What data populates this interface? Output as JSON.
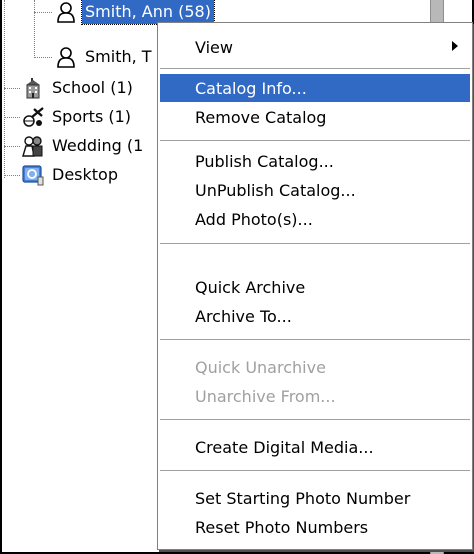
{
  "tree": {
    "items": [
      {
        "label": "Smith, Ann (58)",
        "icon": "person-icon",
        "selected": true
      },
      {
        "label": "Smith, T",
        "icon": "person-icon",
        "selected": false
      },
      {
        "label": "School (1)",
        "icon": "school-icon",
        "selected": false
      },
      {
        "label": "Sports (1)",
        "icon": "sports-icon",
        "selected": false
      },
      {
        "label": "Wedding (1",
        "icon": "wedding-icon",
        "selected": false
      },
      {
        "label": "Desktop",
        "icon": "desktop-icon",
        "selected": false
      }
    ]
  },
  "context_menu": {
    "items": [
      {
        "label": "View",
        "state": "normal",
        "submenu": true
      },
      {
        "label": "Catalog Info...",
        "state": "highlighted"
      },
      {
        "label": "Remove Catalog",
        "state": "normal"
      },
      {
        "label": "Publish Catalog...",
        "state": "normal"
      },
      {
        "label": "UnPublish Catalog...",
        "state": "normal"
      },
      {
        "label": "Add Photo(s)...",
        "state": "normal"
      },
      {
        "label": "Quick Archive",
        "state": "normal"
      },
      {
        "label": "Archive To...",
        "state": "normal"
      },
      {
        "label": "Quick Unarchive",
        "state": "disabled"
      },
      {
        "label": "Unarchive From...",
        "state": "disabled"
      },
      {
        "label": "Create Digital Media...",
        "state": "normal"
      },
      {
        "label": "Set Starting Photo Number",
        "state": "normal"
      },
      {
        "label": "Reset Photo Numbers",
        "state": "normal"
      }
    ]
  },
  "colors": {
    "selection": "#316ac5",
    "disabled_text": "#a0a0a0",
    "menu_background": "#ffffff"
  }
}
